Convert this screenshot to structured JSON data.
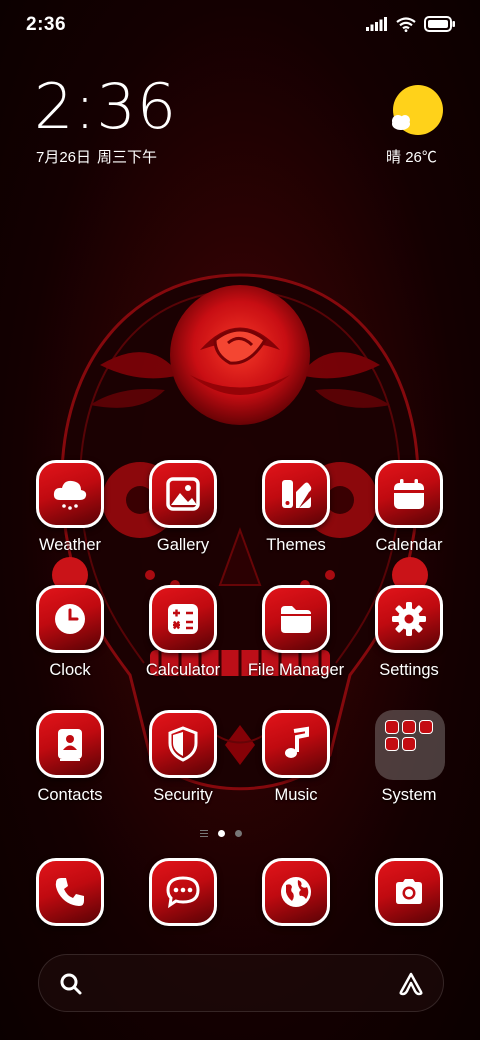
{
  "status_bar": {
    "time": "2:36"
  },
  "clock_widget": {
    "time": "2:36",
    "date": "7月26日",
    "weekday": "周三",
    "period": "下午"
  },
  "weather_widget": {
    "condition": "晴",
    "temperature": "26℃",
    "icon": "sun-cloud-icon"
  },
  "apps": [
    {
      "label": "Weather",
      "icon": "weather-cloud-icon"
    },
    {
      "label": "Gallery",
      "icon": "image-icon"
    },
    {
      "label": "Themes",
      "icon": "themes-icon"
    },
    {
      "label": "Calendar",
      "icon": "calendar-icon"
    },
    {
      "label": "Clock",
      "icon": "clock-icon"
    },
    {
      "label": "Calculator",
      "icon": "calculator-icon"
    },
    {
      "label": "File Manager",
      "icon": "folder-icon"
    },
    {
      "label": "Settings",
      "icon": "gear-icon"
    },
    {
      "label": "Contacts",
      "icon": "contacts-icon"
    },
    {
      "label": "Security",
      "icon": "shield-icon"
    },
    {
      "label": "Music",
      "icon": "music-note-icon"
    },
    {
      "label": "System",
      "icon": "folder-group-icon"
    }
  ],
  "dock": [
    {
      "icon": "phone-icon"
    },
    {
      "icon": "message-icon"
    },
    {
      "icon": "browser-globe-icon"
    },
    {
      "icon": "camera-icon"
    }
  ],
  "page_indicator": {
    "pages": 2,
    "current": 1
  },
  "search": {
    "placeholder": ""
  },
  "colors": {
    "accent": "#d0101a",
    "background": "#140001"
  }
}
